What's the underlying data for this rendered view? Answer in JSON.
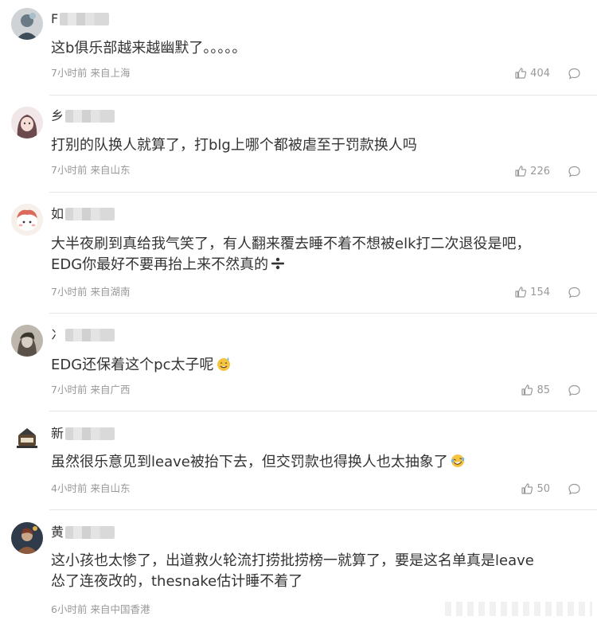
{
  "comments": [
    {
      "name_initial": "F",
      "text_lines": [
        "这b俱乐部越来越幽默了。。。。。"
      ],
      "time": "7小时前",
      "location": "来自上海",
      "likes": "404"
    },
    {
      "name_initial": "乡",
      "text_lines": [
        "打别的队换人就算了，打blg上哪个都被虐至于罚款换人吗"
      ],
      "time": "7小时前",
      "location": "来自山东",
      "likes": "226"
    },
    {
      "name_initial": "如",
      "text_lines": [
        "大半夜刷到真给我气笑了，有人翻来覆去睡不着不想被elk打二次退役是吧，",
        "EDG你最好不要再抬上来不然真的"
      ],
      "time": "7小时前",
      "location": "来自湖南",
      "likes": "154"
    },
    {
      "name_initial": "冫",
      "text_lines": [
        "EDG还保着这个pc太子呢"
      ],
      "time": "7小时前",
      "location": "来自广西",
      "likes": "85"
    },
    {
      "name_initial": "新",
      "text_lines": [
        "虽然很乐意见到leave被抬下去，但交罚款也得换人也太抽象了"
      ],
      "time": "4小时前",
      "location": "来自山东",
      "likes": "50"
    },
    {
      "name_initial": "黄",
      "text_lines": [
        "这小孩也太惨了，出道救火轮流打捞批捞榜一就算了，要是这名单真是leave",
        "怂了连夜改的，thesnake估计睡不着了"
      ],
      "time": "6小时前",
      "location": "来自中国香港",
      "likes": ""
    }
  ],
  "icons": {
    "like": "thumbs-up-icon",
    "reply": "comment-bubble-icon",
    "emoji_divide": "divide-sign-emoji",
    "emoji_sweat": "sweat-smile-emoji",
    "emoji_laugh": "laughing-tears-emoji"
  },
  "colors": {
    "text": "#333333",
    "meta": "#999999",
    "divider": "#e6e6e6"
  }
}
